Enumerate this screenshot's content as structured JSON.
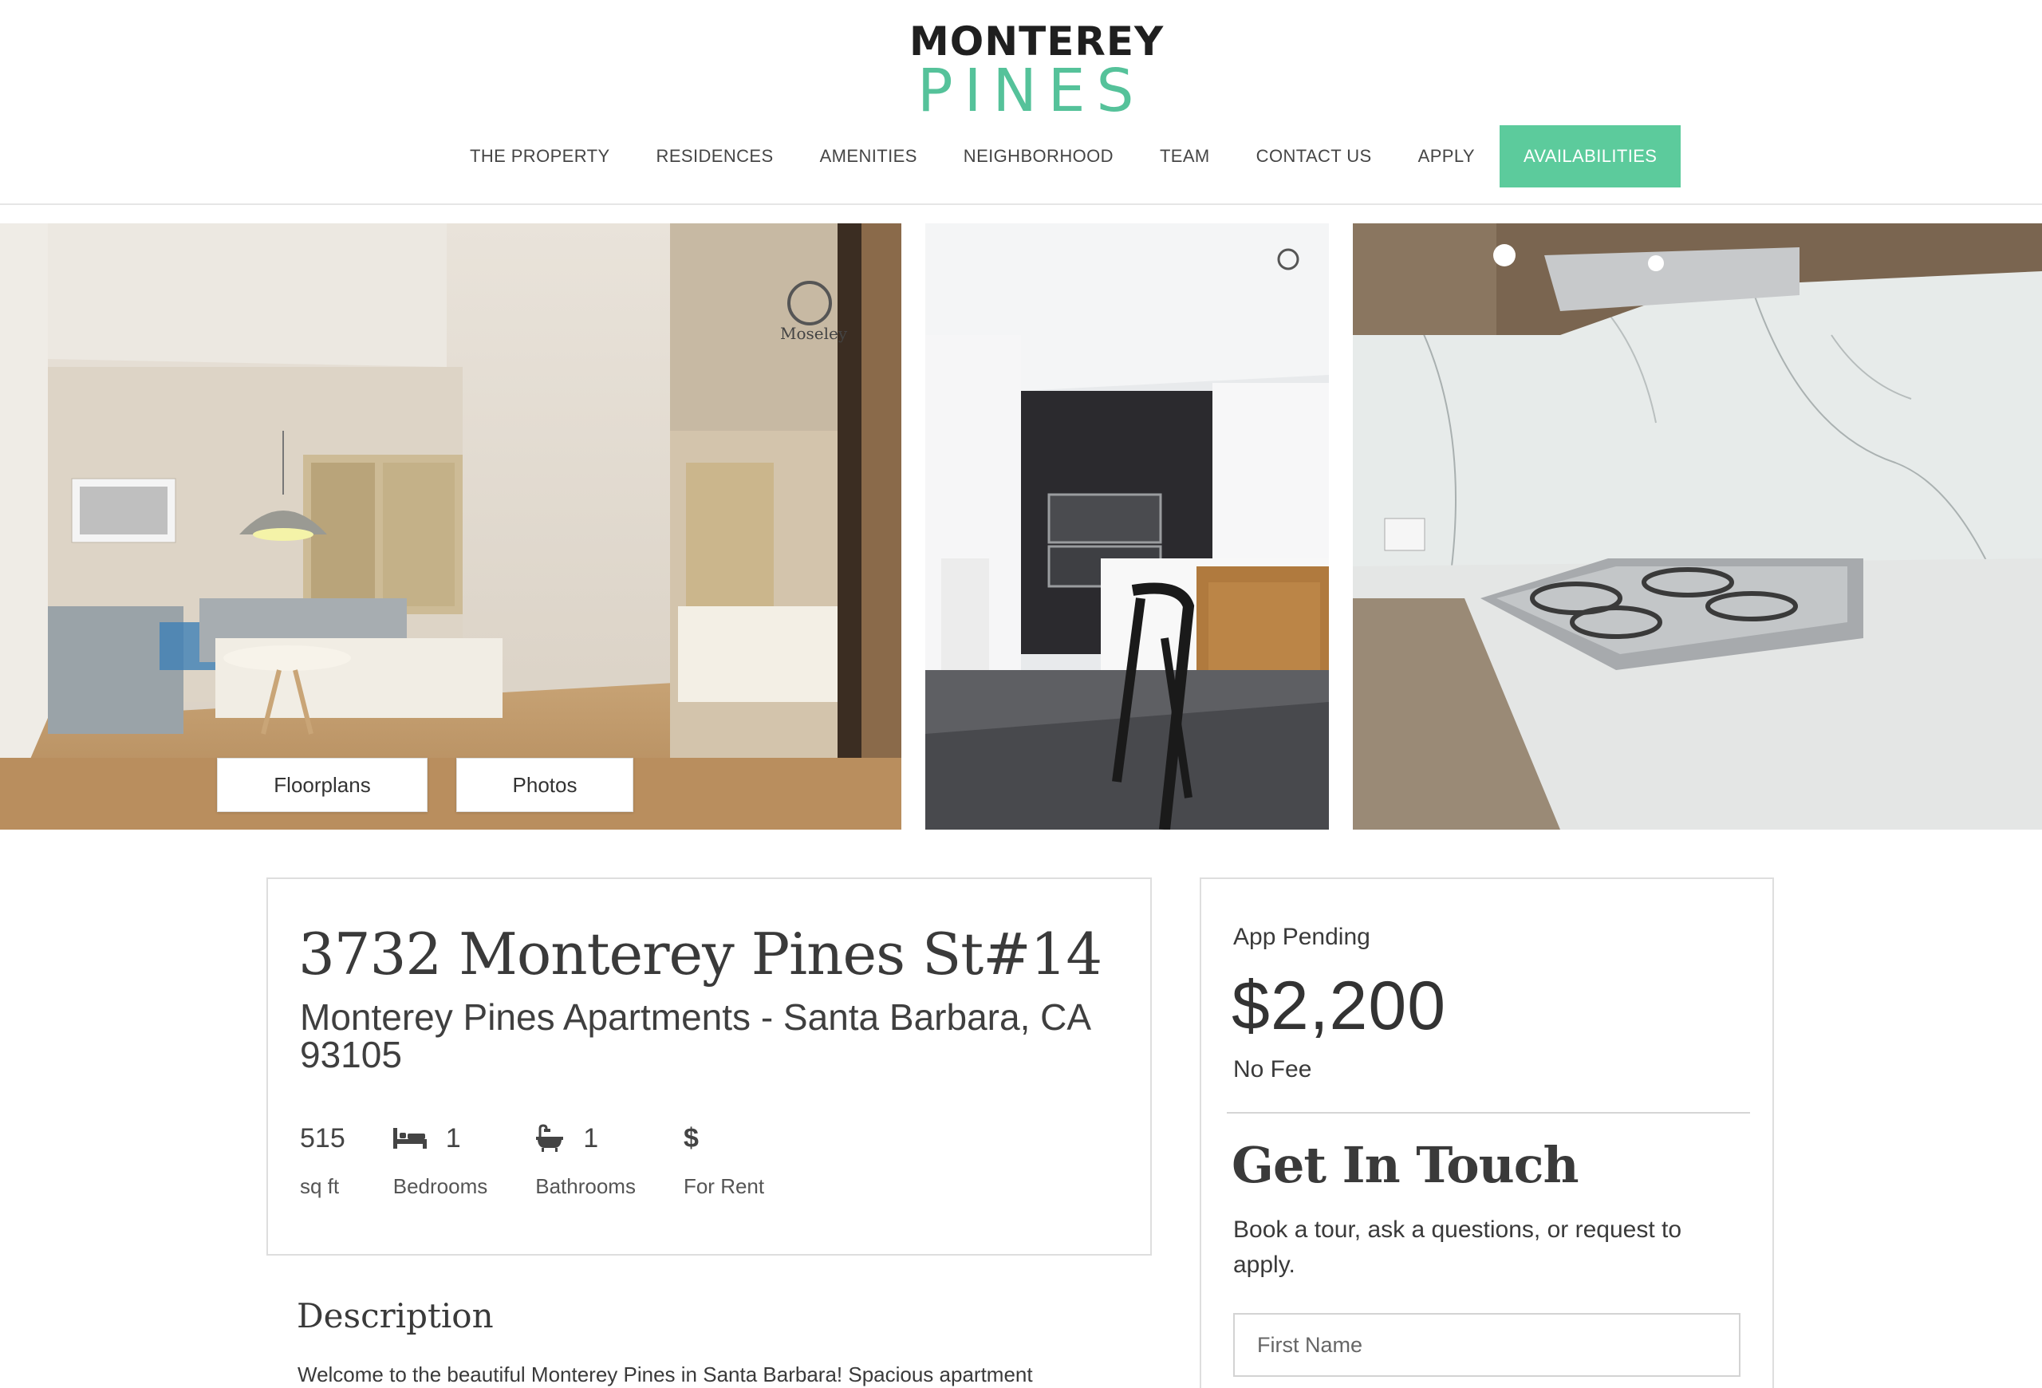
{
  "brand": {
    "line1": "MONTEREY",
    "line2": "PINES",
    "accent": "#5ccb9c"
  },
  "nav": {
    "items": [
      "THE PROPERTY",
      "RESIDENCES",
      "AMENITIES",
      "NEIGHBORHOOD",
      "TEAM",
      "CONTACT US",
      "APPLY"
    ],
    "cta": "AVAILABILITIES"
  },
  "gallery": {
    "photos": [
      "bedroom-photo",
      "kitchen-photo",
      "cooktop-photo"
    ],
    "watermark": "Moseley",
    "buttons": {
      "floorplans": "Floorplans",
      "photos": "Photos"
    }
  },
  "listing": {
    "address": "3732 Monterey Pines St#14",
    "subtitle": "Monterey Pines Apartments - Santa Barbara, CA 93105",
    "stats": {
      "sqft_value": "515",
      "sqft_label": "sq ft",
      "bed_value": "1",
      "bed_label": "Bedrooms",
      "bath_value": "1",
      "bath_label": "Bathrooms",
      "type_value": "$",
      "type_label": "For Rent"
    },
    "description_heading": "Description",
    "description_text": "Welcome to the beautiful Monterey Pines in Santa Barbara! Spacious apartment"
  },
  "sidebar": {
    "status": "App Pending",
    "price": "$2,200",
    "fee": "No Fee",
    "heading": "Get In Touch",
    "text": "Book a tour, ask a questions, or request to apply.",
    "first_name_placeholder": "First Name"
  }
}
